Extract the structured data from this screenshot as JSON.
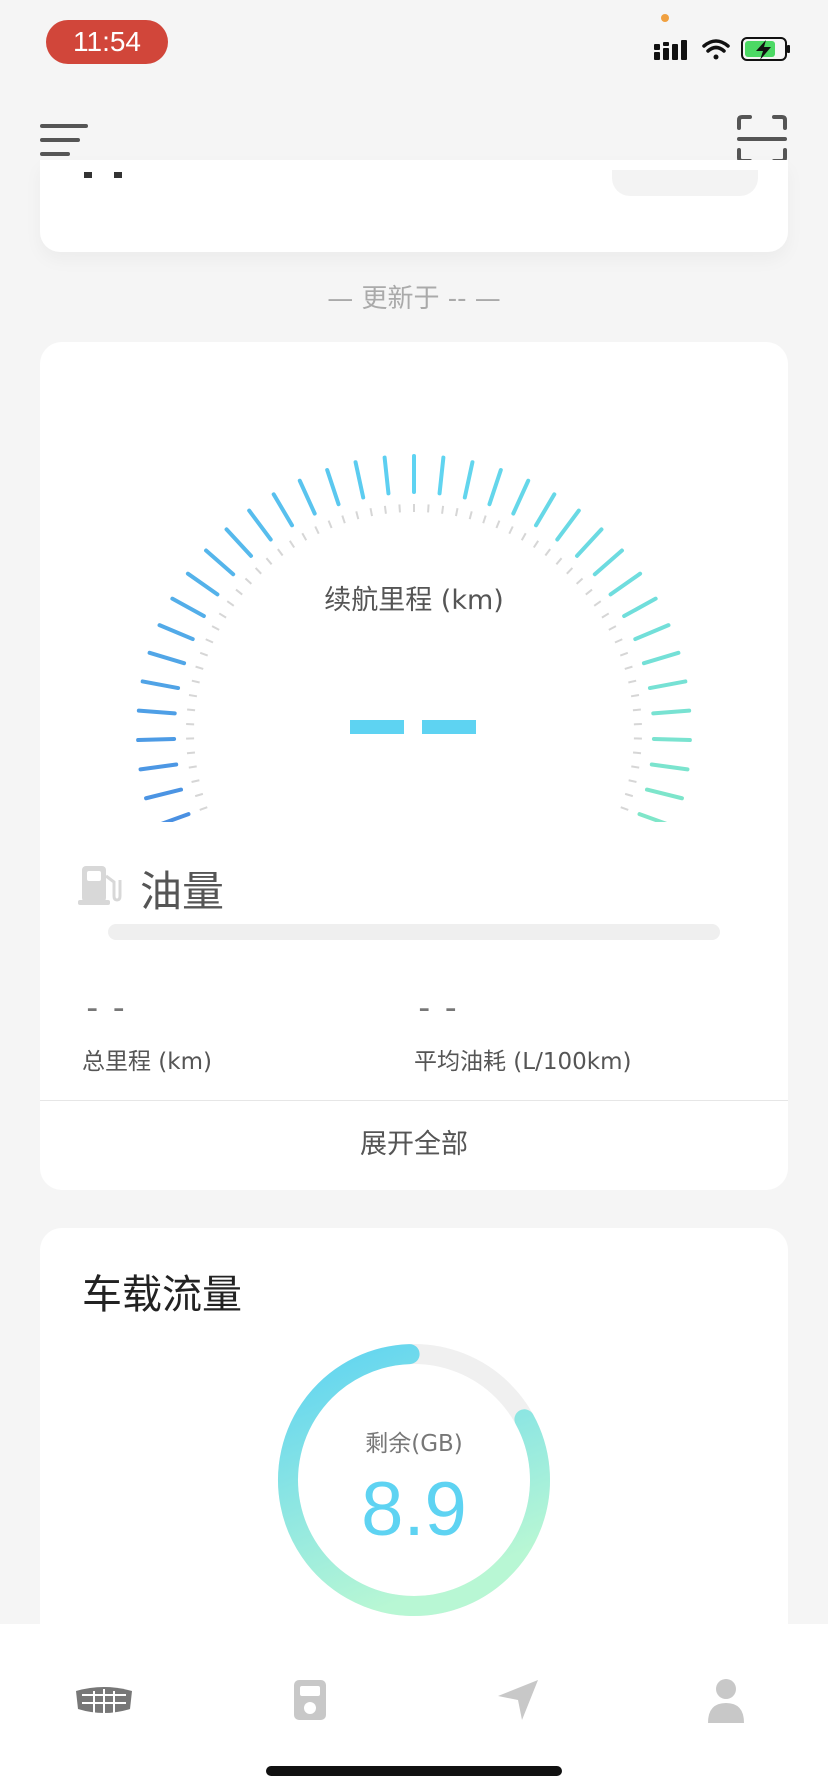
{
  "status_bar": {
    "time": "11:54",
    "icons": [
      "signal-icon",
      "wifi-icon",
      "battery-charging-icon"
    ],
    "accent_colors": {
      "time_pill": "#d1463a",
      "battery": "#4cd964",
      "privacy_dot": "#f0a040"
    }
  },
  "topnav": {
    "icons": [
      "menu-icon",
      "scan-icon"
    ]
  },
  "updated_text": "— 更新于 -- —",
  "gauge": {
    "label": "续航里程 (km)",
    "value": "--",
    "colors": {
      "start": "#4a90e2",
      "mid": "#5ed3f2",
      "end": "#7fe6c9"
    }
  },
  "fuel": {
    "label": "油量",
    "level_fraction": 0,
    "icon": "fuel-pump-icon"
  },
  "stats": [
    {
      "value": "--",
      "label": "总里程 (km)"
    },
    {
      "value": "--",
      "label": "平均油耗 (L/100km)"
    }
  ],
  "expand_label": "展开全部",
  "data_card": {
    "title": "车载流量",
    "remain_label": "剩余(GB)",
    "remain_value": "8.9",
    "used_fraction": 0.17,
    "colors": {
      "start": "#5ed3f2",
      "end": "#b8f7d4",
      "track": "#f0f0f0"
    }
  },
  "tabs": [
    {
      "name": "car",
      "icon": "car-brand-icon"
    },
    {
      "name": "station",
      "icon": "charging-station-icon"
    },
    {
      "name": "navigation",
      "icon": "navigation-arrow-icon"
    },
    {
      "name": "profile",
      "icon": "person-icon"
    }
  ]
}
